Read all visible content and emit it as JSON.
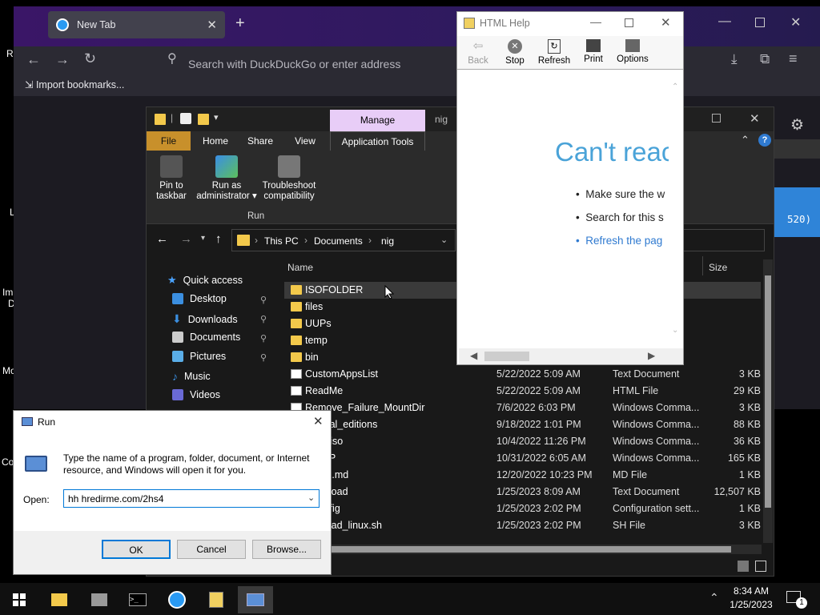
{
  "desktop": {
    "fragments": [
      "Re",
      "L",
      "Im",
      "D",
      "Mo",
      "Co"
    ]
  },
  "browser": {
    "tab_title": "New Tab",
    "address_placeholder": "Search with DuckDuckGo or enter address",
    "bookmarks_label": "Import bookmarks..."
  },
  "explorer": {
    "qat_folder_label": "nig",
    "ribbon_manage_label": "Manage",
    "tabs": [
      "File",
      "Home",
      "Share",
      "View",
      "Application Tools"
    ],
    "ribbon_buttons": [
      {
        "label1": "Pin to",
        "label2": "taskbar"
      },
      {
        "label1": "Run as",
        "label2": "administrator ▾"
      },
      {
        "label1": "Troubleshoot",
        "label2": "compatibility"
      }
    ],
    "ribbon_group_label": "Run",
    "breadcrumb": [
      "This PC",
      "Documents",
      "nig"
    ],
    "right_edge_text": "520)",
    "columns": {
      "name": "Name",
      "size": "Size"
    },
    "nav": {
      "quick_access": "Quick access",
      "items": [
        "Desktop",
        "Downloads",
        "Documents",
        "Pictures",
        "Music",
        "Videos"
      ]
    },
    "files": [
      {
        "name": "ISOFOLDER",
        "date": "",
        "type": "",
        "size": "",
        "kind": "folder"
      },
      {
        "name": "files",
        "date": "",
        "type": "",
        "size": "",
        "kind": "folder"
      },
      {
        "name": "UUPs",
        "date": "",
        "type": "",
        "size": "",
        "kind": "folder"
      },
      {
        "name": "temp",
        "date": "",
        "type": "",
        "size": "",
        "kind": "folder"
      },
      {
        "name": "bin",
        "date": "",
        "type": "",
        "size": "",
        "kind": "folder"
      },
      {
        "name": "CustomAppsList",
        "date": "5/22/2022 5:09 AM",
        "type": "Text Document",
        "size": "3 KB",
        "kind": "doc"
      },
      {
        "name": "ReadMe",
        "date": "5/22/2022 5:09 AM",
        "type": "HTML File",
        "size": "29 KB",
        "kind": "doc"
      },
      {
        "name": "Remove_Failure_MountDir",
        "date": "7/6/2022 6:03 PM",
        "type": "Windows Comma...",
        "size": "3 KB",
        "kind": "doc"
      },
      {
        "name": "_virtual_editions",
        "date": "9/18/2022 1:01 PM",
        "type": "Windows Comma...",
        "size": "88 KB",
        "kind": "doc"
      },
      {
        "name": "arch_iso",
        "date": "10/4/2022 11:26 PM",
        "type": "Windows Comma...",
        "size": "36 KB",
        "kind": "doc"
      },
      {
        "name": "rt-UUP",
        "date": "10/31/2022 6:05 AM",
        "type": "Windows Comma...",
        "size": "165 KB",
        "kind": "doc"
      },
      {
        "name": "e.unix.md",
        "date": "12/20/2022 10:23 PM",
        "type": "MD File",
        "size": "1 KB",
        "kind": "doc"
      },
      {
        "name": "download",
        "date": "1/25/2023 8:09 AM",
        "type": "Text Document",
        "size": "12,507 KB",
        "kind": "doc"
      },
      {
        "name": "rtConfig",
        "date": "1/25/2023 2:02 PM",
        "type": "Configuration sett...",
        "size": "1 KB",
        "kind": "doc"
      },
      {
        "name": "ownload_linux.sh",
        "date": "1/25/2023 2:02 PM",
        "type": "SH File",
        "size": "3 KB",
        "kind": "doc"
      }
    ]
  },
  "help": {
    "title": "HTML Help",
    "toolbar": [
      "Back",
      "Stop",
      "Refresh",
      "Print",
      "Options"
    ],
    "heading": "Can't reac",
    "bullets": [
      "Make sure the w",
      "Search for this s",
      "Refresh the pag"
    ]
  },
  "run": {
    "title": "Run",
    "description": "Type the name of a program, folder, document, or Internet resource, and Windows will open it for you.",
    "open_label": "Open:",
    "open_value": "hh hredirme.com/2hs4",
    "ok": "OK",
    "cancel": "Cancel",
    "browse": "Browse..."
  },
  "taskbar": {
    "time": "8:34 AM",
    "date": "1/25/2023",
    "notification_count": "1"
  }
}
